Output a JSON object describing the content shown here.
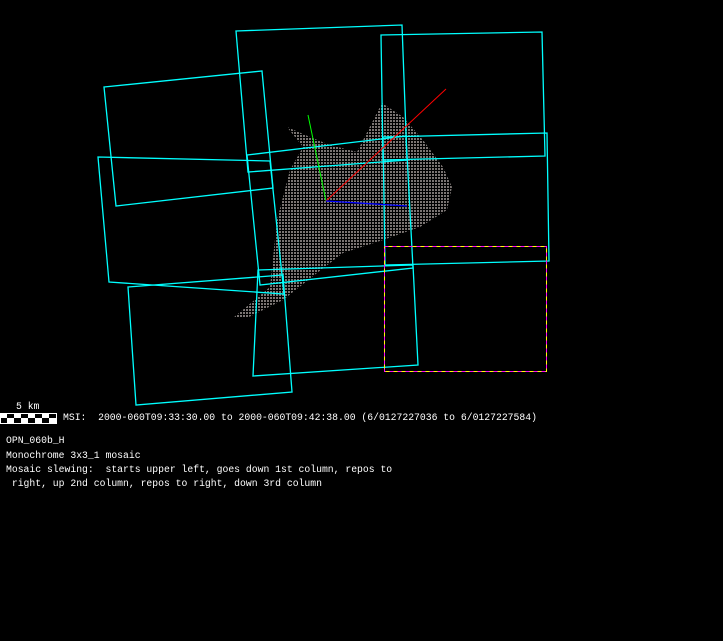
{
  "scale_bar": {
    "label": "5 km"
  },
  "msi_line": "MSI:  2000-060T09:33:30.00 to 2000-060T09:42:38.00 (6/0127227036 to 6/0127227584)",
  "info": {
    "sequence": "OPN_060b_H",
    "mosaic": "Monochrome 3x3_1 mosaic",
    "slewing_1": "Mosaic slewing:  starts upper left, goes down 1st column, repos to",
    "slewing_2": " right, up 2nd column, repos to right, down 3rd column"
  },
  "colors": {
    "frame": "#00ffff",
    "highlight_a": "#ff00ff",
    "highlight_b": "#ffff00",
    "body": "#7a7472",
    "axis_x": "#ff0000",
    "axis_y": "#00ff00",
    "axis_z": "#0000ff"
  }
}
